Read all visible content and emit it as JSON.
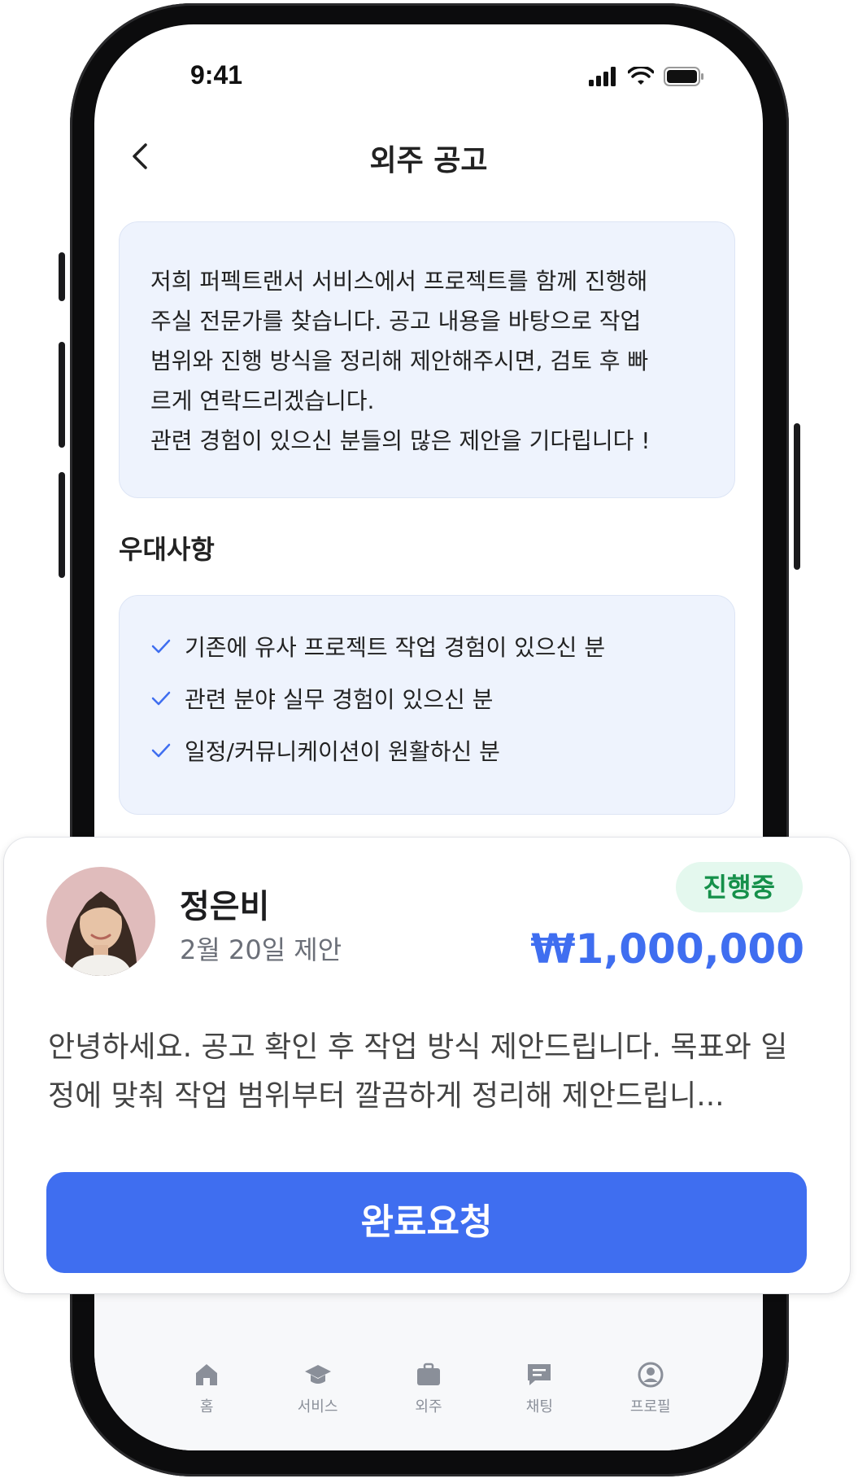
{
  "status_bar": {
    "time": "9:41"
  },
  "header": {
    "title": "외주 공고"
  },
  "intro": {
    "text": "저희 퍼펙트랜서 서비스에서 프로젝트를 함께 진행해\n주실 전문가를 찾습니다. 공고 내용을 바탕으로 작업\n범위와 진행 방식을 정리해 제안해주시면, 검토 후 빠\n르게 연락드리겠습니다.\n관련 경험이 있으신 분들의 많은 제안을 기다립니다 !"
  },
  "perks": {
    "title": "우대사항",
    "items": [
      "기존에 유사 프로젝트 작업 경험이 있으신 분",
      "관련 분야 실무 경험이 있으신 분",
      "일정/커뮤니케이션이 원활하신 분"
    ]
  },
  "proposal": {
    "name": "정은비",
    "date": "2월 20일 제안",
    "status": "진행중",
    "price": "₩1,000,000",
    "message": "안녕하세요. 공고 확인 후 작업 방식 제안드립니다. 목표와 일정에 맞춰 작업 범위부터 깔끔하게 정리해 제안드립니...",
    "button": "완료요청"
  },
  "tabbar": {
    "items": [
      {
        "label": "홈",
        "icon": "home-icon"
      },
      {
        "label": "서비스",
        "icon": "graduation-cap-icon"
      },
      {
        "label": "외주",
        "icon": "briefcase-icon"
      },
      {
        "label": "채팅",
        "icon": "chat-icon"
      },
      {
        "label": "프로필",
        "icon": "profile-icon"
      }
    ]
  },
  "colors": {
    "accent": "#3f6ef0",
    "status_green": "#15904a",
    "status_bg": "#e4f8ee",
    "info_box": "#eef3fd"
  }
}
